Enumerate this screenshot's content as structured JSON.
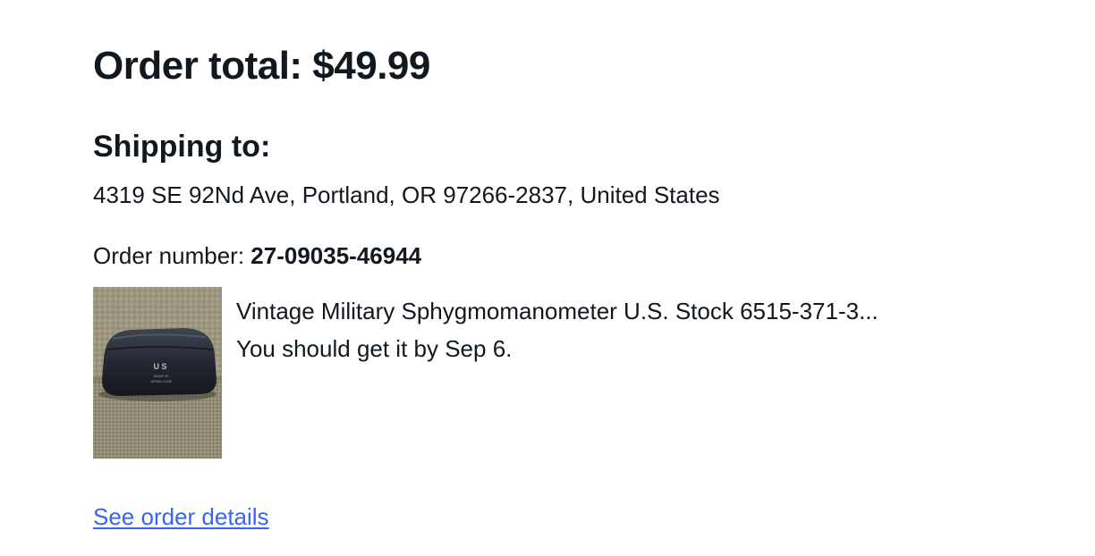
{
  "order": {
    "total_label": "Order total: $49.99"
  },
  "shipping": {
    "title": "Shipping to:",
    "address": "4319 SE 92Nd Ave, Portland, OR 97266-2837, United States"
  },
  "order_number": {
    "label": "Order number: ",
    "value": "27-09035-46944"
  },
  "item": {
    "title": "Vintage Military Sphygmomanometer U.S. Stock 6515-371-3...",
    "delivery": "You should get it by Sep 6.",
    "image_text": {
      "line1": "U S",
      "line2": "MADE IN",
      "line3": "JAPAN CASE"
    }
  },
  "links": {
    "see_order_details": "See order details"
  },
  "colors": {
    "text": "#111820",
    "link": "#3665f3",
    "background": "#ffffff"
  }
}
